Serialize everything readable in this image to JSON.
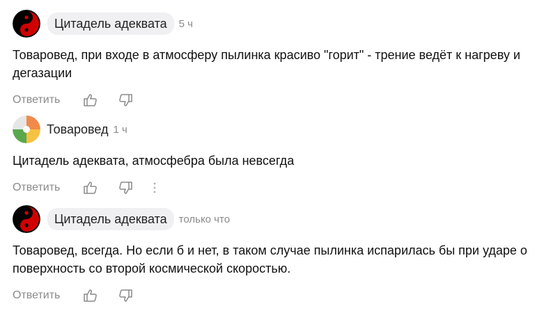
{
  "comments": [
    {
      "author": "Цитадель адеквата",
      "time": "5 ч",
      "text": "Товаровед, при входе в атмосферу пылинка красиво \"горит\" - трение ведёт к нагреву и дегазации",
      "reply_label": "Ответить",
      "avatar_icon": "yin-yang-icon",
      "colors": {
        "avatar_primary": "#d10000",
        "avatar_secondary": "#000000"
      }
    },
    {
      "author": "Товаровед",
      "time": "1 ч",
      "text": "Цитадель адеквата, атмосфебра была невсегда",
      "reply_label": "Ответить",
      "avatar_icon": "quadrant-avatar-icon",
      "colors": {
        "q1": "#f08a4b",
        "q2": "#f5c242",
        "q3": "#5aa84e",
        "q4": "#e6e6e6"
      }
    },
    {
      "author": "Цитадель адеквата",
      "time": "только что",
      "text": "Товаровед, всегда. Но если б и нет, в таком случае пылинка испарилась бы при ударе о поверхность со второй космической скоростью.",
      "reply_label": "Ответить",
      "avatar_icon": "yin-yang-icon",
      "colors": {
        "avatar_primary": "#d10000",
        "avatar_secondary": "#000000"
      }
    }
  ]
}
